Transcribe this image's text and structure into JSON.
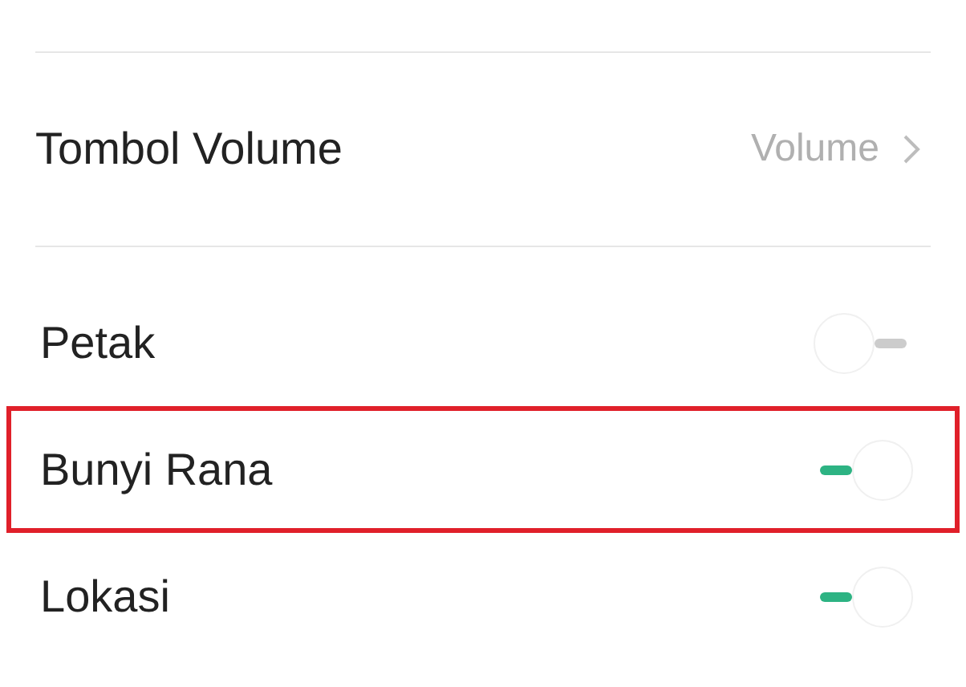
{
  "rows": [
    {
      "kind": "link",
      "label": "Tombol Volume",
      "value": "Volume"
    },
    {
      "kind": "toggle",
      "label": "Petak",
      "on": false,
      "highlighted": false
    },
    {
      "kind": "toggle",
      "label": "Bunyi Rana",
      "on": true,
      "highlighted": true
    },
    {
      "kind": "toggle",
      "label": "Lokasi",
      "on": true,
      "highlighted": false
    }
  ]
}
